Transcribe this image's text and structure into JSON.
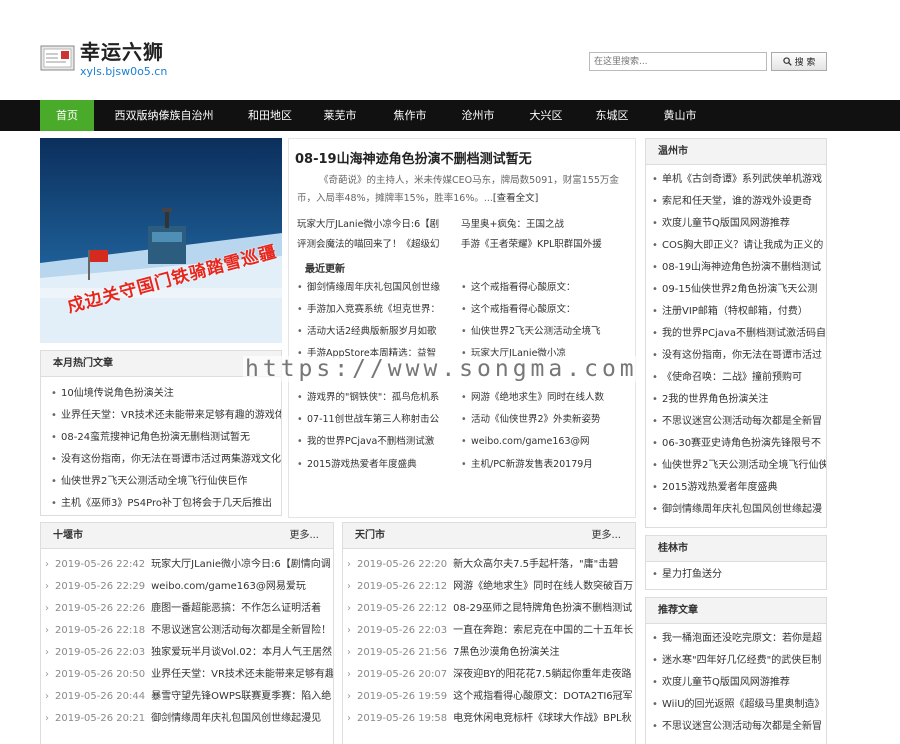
{
  "site": {
    "title": "幸运六狮",
    "domain": "xyls.bjsw0o5.cn"
  },
  "search": {
    "placeholder": "在这里搜索...",
    "button": "搜 索"
  },
  "nav": [
    "首页",
    "西双版纳傣族自治州",
    "和田地区",
    "莱芜市",
    "焦作市",
    "沧州市",
    "大兴区",
    "东城区",
    "黄山市"
  ],
  "featured": {
    "title": "08-19山海神迹角色扮演不删档测试暂无",
    "summary": "《奇葩说》的主持人，米未传媒CEO马东，牌局数5091，财富155万金币，入局率48%，摊牌率15%，胜率16%。...",
    "more": "[查看全文]",
    "pairs": [
      "玩家大厅JLanie微小凉今日:6【剧",
      "马里奥+疯兔：王国之战",
      "评测会魔法的喵回来了！《超级幻",
      "手游《王者荣耀》KPL职群国外援"
    ]
  },
  "recent": {
    "title": "最近更新",
    "items": [
      "御剑情缘周年庆礼包国风创世缘",
      "这个戒指看得心酸原文：",
      "手游加入竞赛系统《坦克世界：",
      "这个戒指看得心酸原文：",
      "活动大话2经典版新服岁月如歌",
      "仙侠世界2飞天公测活动全境飞",
      "手游AppStore本周精选：益智",
      "玩家大厅JLanie微小凉",
      "游戏界的\"钢铁侠\"：孤鸟危机系",
      "网游《绝地求生》同时在线人数",
      "07-11创世战车第三人称射击公",
      "活动《仙侠世界2》外卖新姿势",
      "我的世界PCjava不删档测试激",
      "weibo.com/game163@网",
      "2015游戏热爱者年度盛典",
      "主机/PC新游发售表20179月"
    ]
  },
  "hot_month": {
    "title": "本月热门文章",
    "items": [
      "10仙境传说角色扮演关注",
      "业界任天堂：VR技术还未能带来足够有趣的游戏体",
      "08-24蛮荒搜神记角色扮演无删档测试暂无",
      "没有这份指南，你无法在哥谭市活过两集游戏文化",
      "仙侠世界2飞天公测活动全境飞行仙侠巨作",
      "主机《巫师3》PS4Pro补丁包将会于几天后推出"
    ]
  },
  "wenzhou": {
    "title": "温州市",
    "items": [
      "单机《古剑奇谭》系列武侠单机游戏",
      "索尼和任天堂，谁的游戏外设更奇",
      "欢度儿童节Q版国风网游推荐",
      "COS胸大即正义？请让我成为正义的",
      "08-19山海神迹角色扮演不删档测试",
      "09-15仙侠世界2角色扮演飞天公测",
      "注册VIP邮箱（特权邮箱，付费）",
      "我的世界PCjava不删档测试激活码自",
      "没有这份指南，你无法在哥谭市活过",
      "《使命召唤：二战》撞前预购可",
      "2我的世界角色扮演关注",
      "不思议迷宫公测活动每次都是全新冒",
      "06-30赛亚史诗角色扮演先锋限号不",
      "仙侠世界2飞天公测活动全境飞行仙侠",
      "2015游戏热爱者年度盛典",
      "御剑情缘周年庆礼包国风创世缘起漫"
    ]
  },
  "guilin": {
    "title": "桂林市",
    "items": [
      "星力打鱼送分"
    ]
  },
  "recommend": {
    "title": "推荐文章",
    "items": [
      "我一桶泡面还没吃完原文：若你是超",
      "迷水寒\"四年好几亿经费\"的武侠巨制",
      "欢度儿童节Q版国风网游推荐",
      "WiiU的回光返照《超级马里奥制造》",
      "不思议迷宫公测活动每次都是全新冒"
    ]
  },
  "shiyan": {
    "title": "十堰市",
    "more": "更多...",
    "rows": [
      {
        "date": "2019-05-26 22:42",
        "text": "玩家大厅JLanie微小凉今日:6【剧情向调"
      },
      {
        "date": "2019-05-26 22:29",
        "text": "weibo.com/game163@网易爱玩"
      },
      {
        "date": "2019-05-26 22:26",
        "text": "鹿图一番超能恶搞：不作怎么证明活着"
      },
      {
        "date": "2019-05-26 22:18",
        "text": "不思议迷宫公测活动每次都是全新冒险！"
      },
      {
        "date": "2019-05-26 22:03",
        "text": "独家爱玩半月谈Vol.02：本月人气王居然"
      },
      {
        "date": "2019-05-26 20:50",
        "text": "业界任天堂：VR技术还未能带来足够有趣"
      },
      {
        "date": "2019-05-26 20:44",
        "text": "暴雪守望先锋OWPS联赛夏季赛：陷入绝"
      },
      {
        "date": "2019-05-26 20:21",
        "text": "御剑情缘周年庆礼包国风创世缘起漫见"
      }
    ]
  },
  "tianmen": {
    "title": "天门市",
    "more": "更多...",
    "rows": [
      {
        "date": "2019-05-26 22:20",
        "text": "新大众高尔夫7.5手起杆落，\"庸\"击碧"
      },
      {
        "date": "2019-05-26 22:12",
        "text": "网游《绝地求生》同时在线人数突破百万"
      },
      {
        "date": "2019-05-26 22:12",
        "text": "08-29巫师之昆特牌角色扮演不删档测试"
      },
      {
        "date": "2019-05-26 22:03",
        "text": "一直在奔跑：索尼克在中国的二十五年长"
      },
      {
        "date": "2019-05-26 21:56",
        "text": "7黑色沙漠角色扮演关注"
      },
      {
        "date": "2019-05-26 20:07",
        "text": "深夜迎BY的阳花花7.5躺起你重年走夜路"
      },
      {
        "date": "2019-05-26 19:59",
        "text": "这个戒指看得心酸原文：DOTA2TI6冠军"
      },
      {
        "date": "2019-05-26 19:58",
        "text": "电竞休闲电竞标杆《球球大作战》BPL秋"
      }
    ]
  },
  "watermark": "https://www.songma.com",
  "hero": {
    "caption": "戍边关守国门铁骑踏雪巡疆"
  },
  "colors": {
    "nav_bg": "#111111",
    "nav_active": "#4aab2a",
    "link_blue": "#1b7fd3"
  }
}
